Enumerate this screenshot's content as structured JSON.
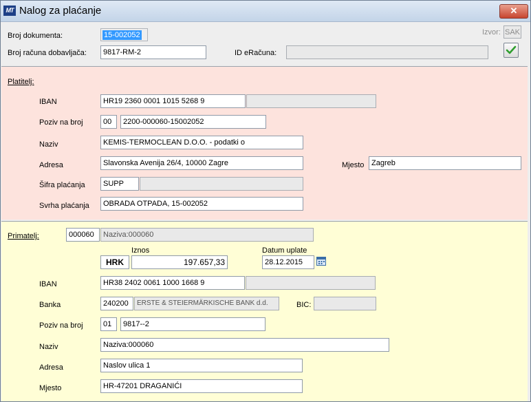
{
  "window": {
    "title": "Nalog za plaćanje",
    "close_label": "✕"
  },
  "header": {
    "broj_dokumenta_label": "Broj dokumenta:",
    "broj_dokumenta_value": "15-002052",
    "broj_racuna_label": "Broj računa dobavljača:",
    "broj_racuna_value": "9817-RM-2",
    "id_eracuna_label": "ID eRačuna:",
    "id_eracuna_value": "",
    "izvor_label": "Izvor:",
    "izvor_value": "SAK"
  },
  "platitelj": {
    "section_label": "Platitelj:",
    "iban_label": "IBAN",
    "iban_value": "HR19 2360 0001 1015 5268 9",
    "iban_extra": "",
    "poziv_label": "Poziv na broj",
    "poziv_model": "00",
    "poziv_value": "2200-000060-15002052",
    "naziv_label": "Naziv",
    "naziv_value": "KEMIS-TERMOCLEAN D.O.O. - podatki o",
    "adresa_label": "Adresa",
    "adresa_value": "Slavonska Avenija 26/4, 10000 Zagre",
    "mjesto_label": "Mjesto",
    "mjesto_value": "Zagreb",
    "sifra_label": "Šifra plaćanja",
    "sifra_value": "SUPP",
    "sifra_extra": "",
    "svrha_label": "Svrha plaćanja",
    "svrha_value": "OBRADA OTPADA, 15-002052"
  },
  "primatelj": {
    "section_label": "Primatelj:",
    "code_value": "000060",
    "naziv_ro": "Naziva:000060",
    "iznos_label": "Iznos",
    "currency": "HRK",
    "iznos_value": "197.657,33",
    "datum_label": "Datum uplate",
    "datum_value": "28.12.2015",
    "iban_label": "IBAN",
    "iban_value": "HR38 2402 0061 1000 1668 9",
    "iban_extra": "",
    "banka_label": "Banka",
    "banka_code": "240200",
    "banka_name": "ERSTE & STEIERMÄRKISCHE BANK d.d.",
    "bic_label": "BIC:",
    "bic_value": "",
    "poziv_label": "Poziv na broj",
    "poziv_model": "01",
    "poziv_value": "9817--2",
    "naziv_label": "Naziv",
    "naziv_value": "Naziva:000060",
    "adresa_label": "Adresa",
    "adresa_value": "Naslov ulica 1",
    "mjesto_label": "Mjesto",
    "mjesto_value": "HR-47201  DRAGANIĆI"
  },
  "colors": {
    "platitelj_bg": "#fde3dd",
    "primatelj_bg": "#fffed6",
    "selection": "#3399ff"
  }
}
